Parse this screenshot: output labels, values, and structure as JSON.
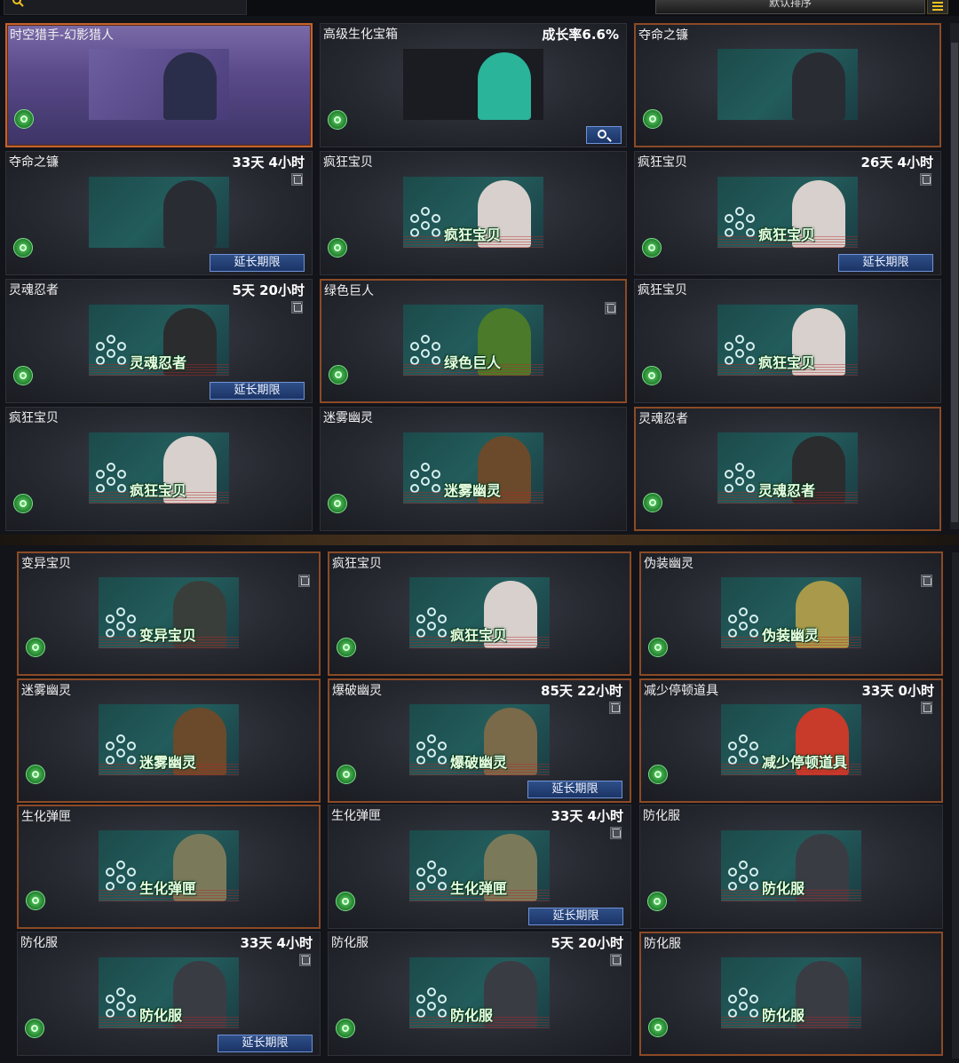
{
  "toolbar": {
    "search_icon": "search-icon",
    "sort_label": "默认排序",
    "menu_icon": "menu-icon"
  },
  "top_panel": {
    "cards": [
      {
        "name": "时空猎手-幻影猎人",
        "time": "",
        "thumb_label": "",
        "extend": "",
        "figure_color": "#2b2e4a",
        "bg": "purple"
      },
      {
        "name": "高级生化宝箱",
        "time": "成长率6.6%",
        "thumb_label": "",
        "extend": "",
        "figure_color": "#2ab49a",
        "bg": "dark"
      },
      {
        "name": "夺命之镰",
        "time": "",
        "thumb_label": "",
        "extend": "",
        "figure_color": "#2a2c34",
        "bg": ""
      },
      {
        "name": "夺命之镰",
        "time": "33天 4小时",
        "thumb_label": "",
        "extend": "延长期限",
        "figure_color": "#2a2c34",
        "bg": ""
      },
      {
        "name": "疯狂宝贝",
        "time": "",
        "thumb_label": "疯狂宝贝",
        "extend": "",
        "figure_color": "#d8d0cc",
        "bg": ""
      },
      {
        "name": "疯狂宝贝",
        "time": "26天 4小时",
        "thumb_label": "疯狂宝贝",
        "extend": "延长期限",
        "figure_color": "#d8d0cc",
        "bg": ""
      },
      {
        "name": "灵魂忍者",
        "time": "5天 20小时",
        "thumb_label": "灵魂忍者",
        "extend": "延长期限",
        "figure_color": "#2a2c2e",
        "bg": ""
      },
      {
        "name": "绿色巨人",
        "time": "",
        "thumb_label": "绿色巨人",
        "extend": "",
        "figure_color": "#4a7a2a",
        "bg": ""
      },
      {
        "name": "疯狂宝贝",
        "time": "",
        "thumb_label": "疯狂宝贝",
        "extend": "",
        "figure_color": "#d8d0cc",
        "bg": ""
      },
      {
        "name": "疯狂宝贝",
        "time": "",
        "thumb_label": "疯狂宝贝",
        "extend": "",
        "figure_color": "#d8d0cc",
        "bg": ""
      },
      {
        "name": "迷雾幽灵",
        "time": "",
        "thumb_label": "迷雾幽灵",
        "extend": "",
        "figure_color": "#6a4a2a",
        "bg": ""
      },
      {
        "name": "灵魂忍者",
        "time": "",
        "thumb_label": "灵魂忍者",
        "extend": "",
        "figure_color": "#2a2c2e",
        "bg": ""
      }
    ]
  },
  "bottom_panel": {
    "cards": [
      {
        "name": "变异宝贝",
        "time": "",
        "thumb_label": "变异宝贝",
        "extend": "",
        "figure_color": "#3a3e3a",
        "bg": ""
      },
      {
        "name": "疯狂宝贝",
        "time": "",
        "thumb_label": "疯狂宝贝",
        "extend": "",
        "figure_color": "#d8d0cc",
        "bg": ""
      },
      {
        "name": "伪装幽灵",
        "time": "",
        "thumb_label": "伪装幽灵",
        "extend": "",
        "figure_color": "#a89a4a",
        "bg": ""
      },
      {
        "name": "迷雾幽灵",
        "time": "",
        "thumb_label": "迷雾幽灵",
        "extend": "",
        "figure_color": "#6a4a2a",
        "bg": ""
      },
      {
        "name": "爆破幽灵",
        "time": "85天 22小时",
        "thumb_label": "爆破幽灵",
        "extend": "延长期限",
        "figure_color": "#7a6a4a",
        "bg": ""
      },
      {
        "name": "减少停顿道具",
        "time": "33天 0小时",
        "thumb_label": "减少停顿道具",
        "extend": "",
        "figure_color": "#c83a2a",
        "bg": ""
      },
      {
        "name": "生化弹匣",
        "time": "",
        "thumb_label": "生化弹匣",
        "extend": "",
        "figure_color": "#7a7a5a",
        "bg": ""
      },
      {
        "name": "生化弹匣",
        "time": "33天 4小时",
        "thumb_label": "生化弹匣",
        "extend": "延长期限",
        "figure_color": "#7a7a5a",
        "bg": ""
      },
      {
        "name": "防化服",
        "time": "",
        "thumb_label": "防化服",
        "extend": "",
        "figure_color": "#3a3c44",
        "bg": ""
      },
      {
        "name": "防化服",
        "time": "33天 4小时",
        "thumb_label": "防化服",
        "extend": "延长期限",
        "figure_color": "#3a3c44",
        "bg": ""
      },
      {
        "name": "防化服",
        "time": "5天 20小时",
        "thumb_label": "防化服",
        "extend": "",
        "figure_color": "#3a3c44",
        "bg": ""
      },
      {
        "name": "防化服",
        "time": "",
        "thumb_label": "防化服",
        "extend": "",
        "figure_color": "#3a3c44",
        "bg": ""
      }
    ]
  }
}
